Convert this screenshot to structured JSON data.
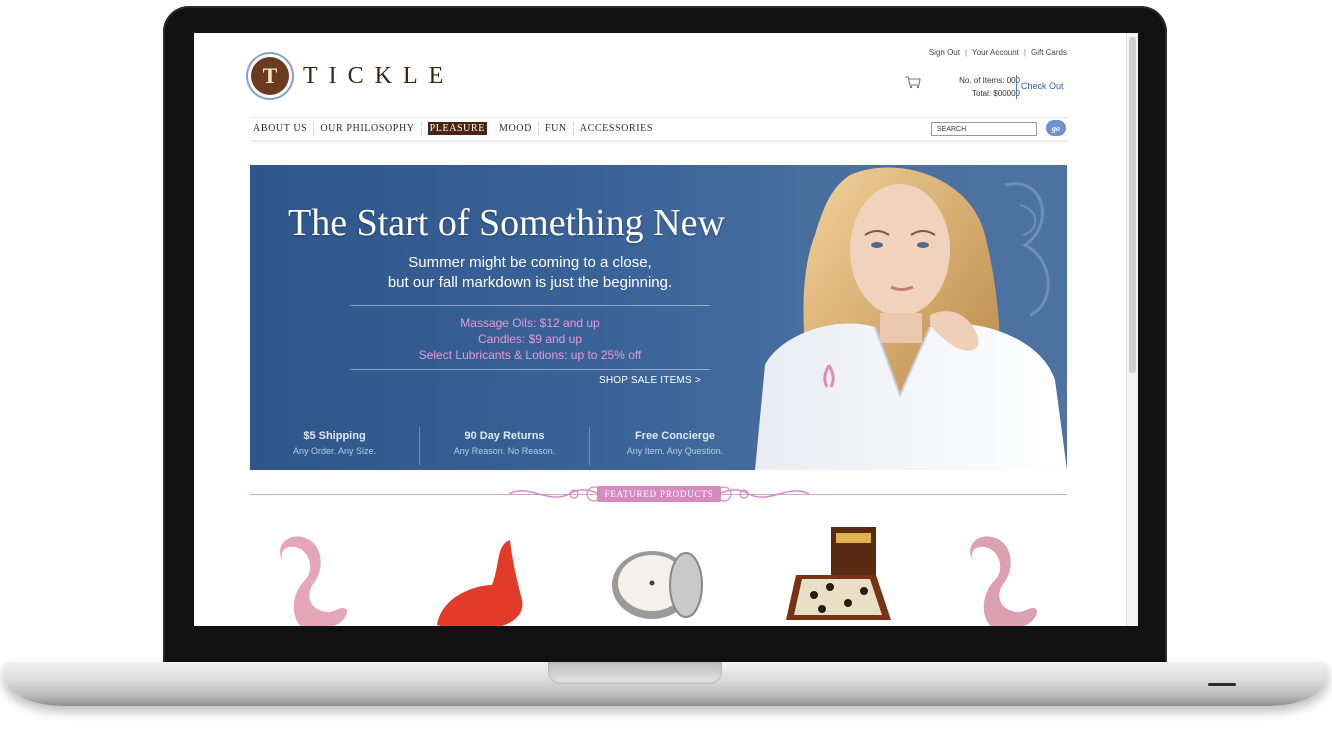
{
  "brand": {
    "logo_letter": "T",
    "name": "TICKLE"
  },
  "account": {
    "sign_out": "Sign Out",
    "your_account": "Your Account",
    "gift_cards": "Gift Cards",
    "separator": "|"
  },
  "cart": {
    "items_line": "No. of Items:  000",
    "total_line": "Total:  $00000",
    "checkout": "Check Out"
  },
  "nav": {
    "items": [
      "ABOUT US",
      "OUR PHILOSOPHY",
      "PLEASURE",
      "MOOD",
      "FUN",
      "ACCESSORIES"
    ],
    "active": "PLEASURE"
  },
  "search": {
    "placeholder": "SEARCH",
    "button": "go"
  },
  "hero": {
    "title": "The Start of Something New",
    "sub_line1": "Summer might be coming to a close,",
    "sub_line2": "but our fall markdown is just the beginning.",
    "offers": [
      "Massage Oils: $12 and up",
      "Candles: $9 and up",
      "Select Lubricants & Lotions: up to 25% off"
    ],
    "cta": "SHOP SALE ITEMS >"
  },
  "perks": [
    {
      "title": "$5 Shipping",
      "sub": "Any Order. Any Size."
    },
    {
      "title": "90 Day Returns",
      "sub": "Any Reason. No Reason."
    },
    {
      "title": "Free Concierge",
      "sub": "Any Item. Any Question."
    }
  ],
  "featured": {
    "label": "FEATURED PRODUCTS"
  },
  "colors": {
    "brand_brown": "#4a2410",
    "hero_blue": "#3a6398",
    "accent_pink": "#d58bc0",
    "link_blue": "#2a5fb8"
  },
  "icons": [
    "cart-icon",
    "logo-mark"
  ]
}
